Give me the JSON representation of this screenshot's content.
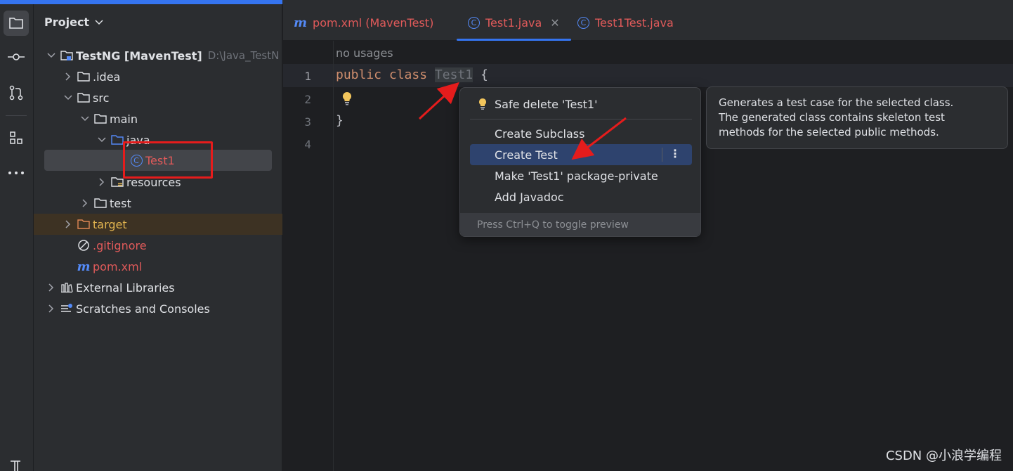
{
  "project_panel": {
    "title": "Project",
    "tree": [
      {
        "label": "TestNG [MavenTest]",
        "path": "D:\\Java_TestN"
      },
      {
        "label": ".idea"
      },
      {
        "label": "src"
      },
      {
        "label": "main"
      },
      {
        "label": "java"
      },
      {
        "label": "Test1"
      },
      {
        "label": "resources"
      },
      {
        "label": "test"
      },
      {
        "label": "target"
      },
      {
        "label": ".gitignore"
      },
      {
        "label": "pom.xml"
      },
      {
        "label": "External Libraries"
      },
      {
        "label": "Scratches and Consoles"
      }
    ]
  },
  "tabs": [
    {
      "label": "pom.xml (MavenTest)"
    },
    {
      "label": "Test1.java",
      "active": true
    },
    {
      "label": "Test1Test.java"
    }
  ],
  "editor": {
    "usages": "no usages",
    "line_numbers": [
      "1",
      "2",
      "3",
      "4"
    ],
    "code": {
      "kw1": "public",
      "kw2": "class",
      "name": "Test1",
      "open": "{",
      "close": "}"
    }
  },
  "intention_popup": {
    "items": [
      {
        "label": "Safe delete 'Test1'"
      },
      {
        "label": "Create Subclass"
      },
      {
        "label": "Create Test",
        "highlighted": true
      },
      {
        "label": "Make 'Test1' package-private"
      },
      {
        "label": "Add Javadoc"
      }
    ],
    "footer": "Press Ctrl+Q to toggle preview"
  },
  "preview": {
    "lines": [
      "Generates a test case for the selected class.",
      "The generated class contains skeleton test",
      "methods for the selected public methods."
    ]
  },
  "watermark": "CSDN @小浪学编程",
  "colors": {
    "accent": "#3574f0",
    "annotation": "#e51c1c",
    "excluded": "#e0b34f"
  }
}
